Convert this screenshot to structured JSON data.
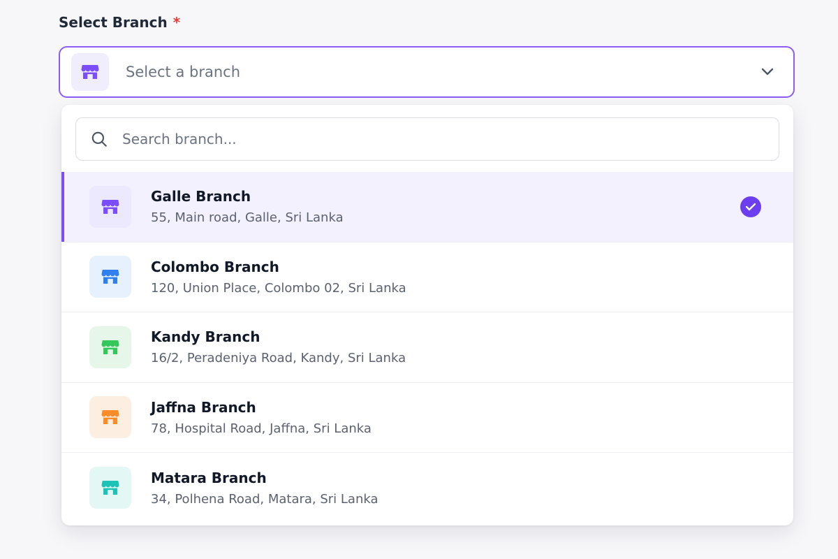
{
  "field": {
    "label": "Select Branch",
    "required_mark": "*",
    "placeholder": "Select a branch"
  },
  "search": {
    "placeholder": "Search branch..."
  },
  "selected_index": 0,
  "branches": [
    {
      "name": "Galle Branch",
      "address": "55, Main road, Galle, Sri Lanka",
      "icon": "store-icon",
      "color": "#7c4dff",
      "bg": "#ece8fd",
      "selected": true
    },
    {
      "name": "Colombo Branch",
      "address": "120, Union Place, Colombo 02, Sri Lanka",
      "icon": "store-icon",
      "color": "#2f80ed",
      "bg": "#e6f1fd",
      "selected": false
    },
    {
      "name": "Kandy Branch",
      "address": "16/2, Peradeniya Road, Kandy, Sri Lanka",
      "icon": "store-icon",
      "color": "#34c759",
      "bg": "#e6f7ea",
      "selected": false
    },
    {
      "name": "Jaffna Branch",
      "address": "78, Hospital Road, Jaffna, Sri Lanka",
      "icon": "store-icon",
      "color": "#fb8c2a",
      "bg": "#fdeee2",
      "selected": false
    },
    {
      "name": "Matara Branch",
      "address": "34, Polhena Road, Matara, Sri Lanka",
      "icon": "store-icon",
      "color": "#1cc2b5",
      "bg": "#e3f7f5",
      "selected": false
    }
  ],
  "colors": {
    "accent": "#7c4dff",
    "select_border": "#8b5cf6",
    "required": "#e53935",
    "check_bg": "#6d3ef0"
  }
}
